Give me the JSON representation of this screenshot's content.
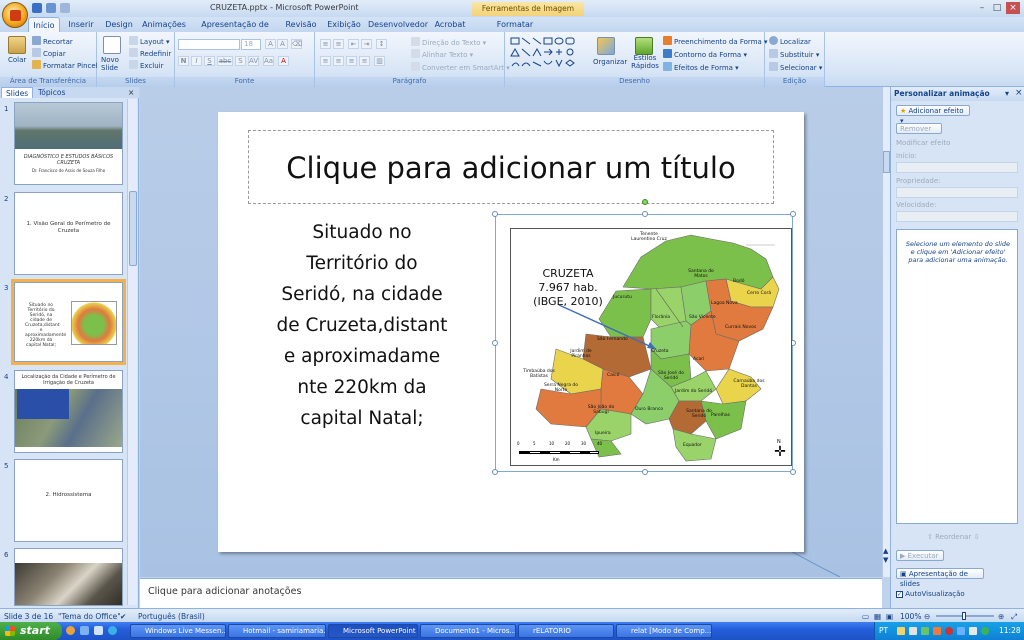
{
  "window": {
    "title": "CRUZETA.pptx - Microsoft PowerPoint",
    "contextual_tab_header": "Ferramentas de Imagem"
  },
  "tabs": [
    "Início",
    "Inserir",
    "Design",
    "Animações",
    "Apresentação de Slides",
    "Revisão",
    "Exibição",
    "Desenvolvedor",
    "Acrobat",
    "Formatar"
  ],
  "ribbon": {
    "clipboard": {
      "paste": "Colar",
      "cut": "Recortar",
      "copy": "Copiar",
      "format_painter": "Formatar Pincel",
      "label": "Área de Transferência"
    },
    "slides": {
      "new_slide": "Novo Slide",
      "layout": "Layout",
      "reset": "Redefinir",
      "delete": "Excluir",
      "label": "Slides"
    },
    "font": {
      "font_size": "18",
      "bold": "N",
      "italic": "I",
      "underline": "S",
      "strike": "abc",
      "shadow": "S",
      "label": "Fonte"
    },
    "paragraph": {
      "text_direction": "Direção do Texto",
      "align_text": "Alinhar Texto",
      "smartart": "Converter em SmartArt",
      "label": "Parágrafo"
    },
    "drawing": {
      "arrange": "Organizar",
      "quick_styles": "Estilos Rápidos",
      "shape_fill": "Preenchimento da Forma",
      "shape_outline": "Contorno da Forma",
      "shape_effects": "Efeitos de Forma",
      "label": "Desenho"
    },
    "editing": {
      "find": "Localizar",
      "replace": "Substituir",
      "select": "Selecionar",
      "label": "Edição"
    }
  },
  "slide_pane": {
    "tabs": [
      "Slides",
      "Tópicos"
    ],
    "close": "×",
    "thumbnails": [
      {
        "num": "1",
        "caption": "DIAGNÓSTICO E ESTUDOS BÁSICOS CRUZETA",
        "subcaption": "Dr. Francisco de Assis de Souza Filho"
      },
      {
        "num": "2",
        "caption": "1. Visão Geral do Perímetro de Cruzeta"
      },
      {
        "num": "3",
        "caption": "Situado no Território do Seridó, na cidade de Cruzeta,distant e aproximadamente 220km da capital Natal;"
      },
      {
        "num": "4",
        "caption": "Localização da Cidade e Perímetro de Irrigação de Cruzeta"
      },
      {
        "num": "5",
        "caption": "2. Hidrossistema"
      },
      {
        "num": "6",
        "caption": ""
      }
    ]
  },
  "slide": {
    "title_placeholder": "Clique para adicionar um título",
    "body_text": "Situado no Território do Seridó, na cidade de Cruzeta,distant e aproximadame nte 220km da capital Natal;",
    "map": {
      "callout_line1": "CRUZETA",
      "callout_line2": "7.967 hab.",
      "callout_line3": "(IBGE, 2010)",
      "labels": [
        "Tenente Laurentino Cruz",
        "Santana do Matos",
        "Bodó",
        "Jucurutu",
        "Lagoa Nova",
        "Cerro Corá",
        "Florânia",
        "São Vicente",
        "Currais Novos",
        "São Fernando",
        "Jardim de Piranhas",
        "Cruzeta",
        "Acari",
        "Timbaúba dos Batistas",
        "Caicó",
        "São José do Seridó",
        "Carnaúba dos Dantas",
        "Serra Negra do Norte",
        "Jardim do Seridó",
        "São João do Sabugi",
        "Ouro Branco",
        "Santana do Seridó",
        "Parelhas",
        "Ipueira",
        "Equador"
      ],
      "scale_ticks": [
        "0",
        "5",
        "10",
        "20",
        "30",
        "40"
      ],
      "scale_unit": "Km",
      "north": "N"
    }
  },
  "notes": {
    "placeholder": "Clique para adicionar anotações"
  },
  "animation_pane": {
    "title": "Personalizar animação",
    "add_effect": "Adicionar efeito",
    "remove": "Remover",
    "modify_label": "Modificar efeito",
    "start_label": "Início:",
    "property_label": "Propriedade:",
    "speed_label": "Velocidade:",
    "hint": "Selecione um elemento do slide e clique em 'Adicionar efeito' para adicionar uma animação.",
    "reorder": "Reordenar",
    "play": "Executar",
    "slideshow": "Apresentação de slides",
    "autopreview": "AutoVisualização"
  },
  "status": {
    "slide_info": "Slide 3 de 16",
    "theme": "\"Tema do Office\"",
    "language": "Português (Brasil)",
    "zoom": "100%"
  },
  "taskbar": {
    "start": "start",
    "tasks": [
      "Windows Live Messen...",
      "Hotmail - samiriamaria...",
      "Microsoft PowerPoint ...",
      "Documento1 - Micros...",
      "rELATORIO",
      "relat [Modo de Comp..."
    ],
    "lang": "PT",
    "clock": "11:28"
  },
  "colors": {
    "ribbon_blue": "#15428b",
    "selection_orange": "#f6b04a",
    "map_green": "#7cc04c",
    "map_orange": "#e07a3e",
    "map_yellow": "#e9d44c",
    "map_brown": "#b46a35"
  }
}
